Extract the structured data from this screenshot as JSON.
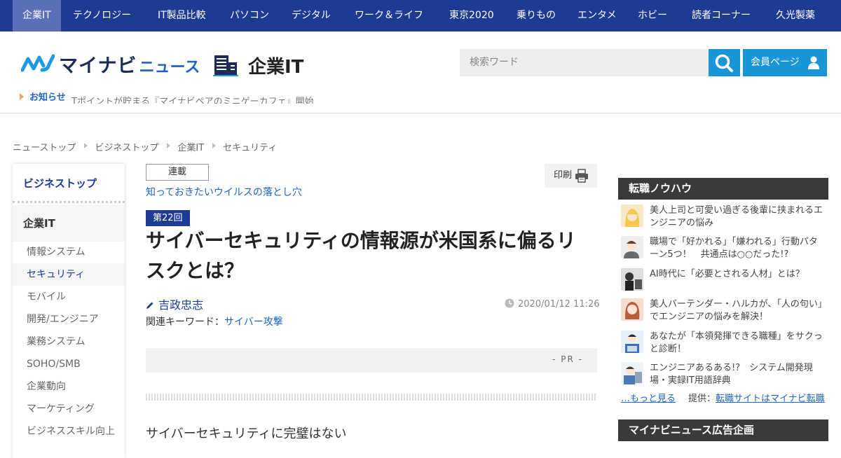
{
  "topnav": {
    "items": [
      "企業IT",
      "テクノロジー",
      "IT製品比較",
      "パソコン",
      "デジタル",
      "ワーク＆ライフ",
      "東京2020",
      "乗りもの",
      "エンタメ",
      "ホビー",
      "読者コーナー",
      "久光製薬"
    ],
    "active_index": 0
  },
  "header": {
    "logo_text": "マイナビ",
    "logo_sub": "ニュース",
    "section_title": "企業IT",
    "search_placeholder": "検索ワード",
    "member_label": "会員ページ",
    "notice_label": "お知らせ",
    "notice_text": "Tポイントが貯まる『マイナビペアのミニゲーカフェ』開始"
  },
  "breadcrumb": [
    "ニューストップ",
    "ビジネストップ",
    "企業IT",
    "セキュリティ"
  ],
  "left_nav": {
    "top_label": "ビジネストップ",
    "category_label": "企業IT",
    "items": [
      "情報システム",
      "セキュリティ",
      "モバイル",
      "開発/エンジニア",
      "業務システム",
      "SOHO/SMB",
      "企業動向",
      "マーケティング",
      "ビジネススキル向上"
    ],
    "active_index": 1
  },
  "article": {
    "series_tag": "連載",
    "series_name": "知っておきたいウイルスの落とし穴",
    "print_label": "印刷",
    "episode": "第22回",
    "title": "サイバーセキュリティの情報源が米国系に偏るリスクとは？",
    "author": "吉政忠志",
    "date": "2020/01/12 11:26",
    "keywords_label": "関連キーワード：",
    "keyword": "サイバー攻撃",
    "pr_label": "- PR -",
    "lead_heading": "サイバーセキュリティに完璧はない"
  },
  "right_sidebar": {
    "career_title": "転職ノウハウ",
    "career_items": [
      "美人上司と可愛い過ぎる後輩に挟まれるエンジニアの悩み",
      "職場で「好かれる」「嫌われる」行動パターン5つ！　共通点は○○だった!?",
      "AI時代に「必要とされる人材」とは？",
      "美人バーテンダー・ハルカが、「人の句い」でエンジニアの悩みを解決！",
      "あなたが「本領発揮できる職種」をサクっと診断！",
      "エンジニアあるある!?　システム開発現場・実録IT用語辞典"
    ],
    "more_label": "…もっと見る",
    "provider_label": "提供：",
    "provider_link": "転職サイトはマイナビ転職",
    "ad_title": "マイナビニュース広告企画"
  },
  "colors": {
    "nav_bg": "#1f3a93",
    "accent_blue": "#1a96d8",
    "link_blue": "#1e64c8",
    "dark_box": "#3a3a3a"
  },
  "icons": [
    "search-icon",
    "user-icon",
    "printer-icon",
    "pencil-icon",
    "clock-icon",
    "building-icon"
  ]
}
